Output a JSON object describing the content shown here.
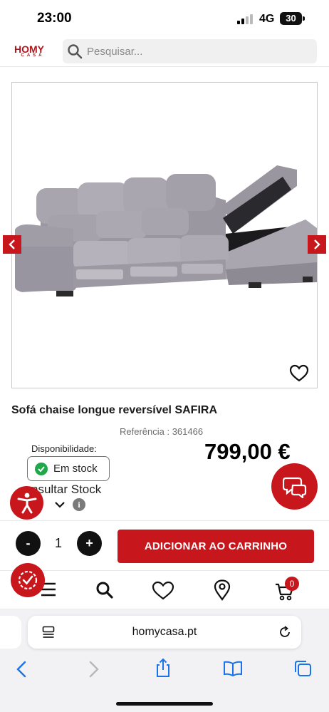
{
  "status_bar": {
    "time": "23:00",
    "network": "4G",
    "battery": "30"
  },
  "header": {
    "logo_main_1": "HO",
    "logo_main_2": "MY",
    "logo_sub": "CASA",
    "search_placeholder": "Pesquisar..."
  },
  "product": {
    "title": "Sofá chaise longue reversível SAFIRA",
    "reference": "Referência : 361466",
    "availability_label": "Disponibilidade:",
    "stock_status": "Em stock",
    "price": "799,00 €",
    "consult_stock": "nsultar Stock",
    "info_symbol": "i"
  },
  "cart": {
    "minus": "-",
    "quantity": "1",
    "plus": "+",
    "add_label": "ADICIONAR AO CARRINHO"
  },
  "bottom_nav": {
    "items": [
      "menu-icon",
      "search-icon",
      "heart-icon",
      "location-icon",
      "cart-icon"
    ],
    "cart_count": "0"
  },
  "browser": {
    "url": "homycasa.pt"
  },
  "colors": {
    "brand_red": "#c8161d",
    "stock_green": "#1ea84a"
  }
}
